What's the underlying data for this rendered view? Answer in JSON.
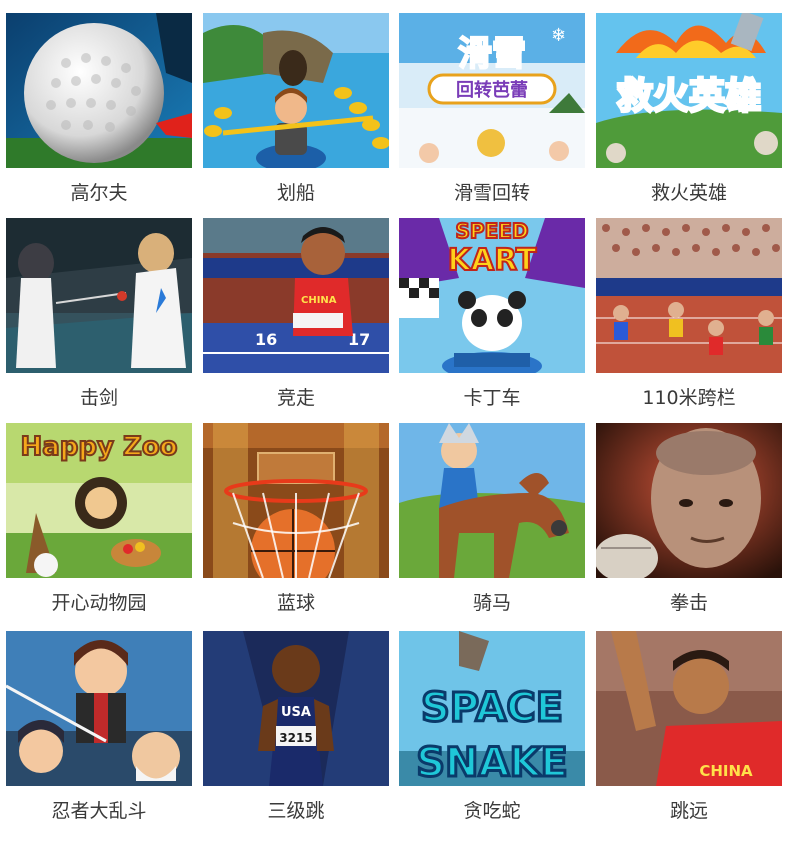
{
  "games": [
    {
      "id": "golf",
      "label": "高尔夫"
    },
    {
      "id": "rowing",
      "label": "划船"
    },
    {
      "id": "ski-slalom",
      "label": "滑雪回转",
      "art_text": "滑雪 回转芭蕾"
    },
    {
      "id": "firefighter",
      "label": "救火英雄",
      "art_text": "救火英雄"
    },
    {
      "id": "fencing",
      "label": "击剑"
    },
    {
      "id": "race-walk",
      "label": "竞走",
      "art_text": [
        "CHINA",
        "16",
        "17"
      ]
    },
    {
      "id": "kart",
      "label": "卡丁车",
      "art_text": [
        "SPEED",
        "KART"
      ]
    },
    {
      "id": "hurdles",
      "label": "110米跨栏"
    },
    {
      "id": "happy-zoo",
      "label": "开心动物园",
      "art_text": "Happy Zoo"
    },
    {
      "id": "basketball",
      "label": "蓝球"
    },
    {
      "id": "horse-riding",
      "label": "骑马"
    },
    {
      "id": "boxing",
      "label": "拳击"
    },
    {
      "id": "ninja-brawl",
      "label": "忍者大乱斗"
    },
    {
      "id": "triple-jump",
      "label": "三级跳",
      "art_text": [
        "USA",
        "3215"
      ]
    },
    {
      "id": "space-snake",
      "label": "贪吃蛇",
      "art_text": [
        "SPACE",
        "SNAKE"
      ]
    },
    {
      "id": "long-jump",
      "label": "跳远",
      "art_text": "CHINA"
    }
  ]
}
